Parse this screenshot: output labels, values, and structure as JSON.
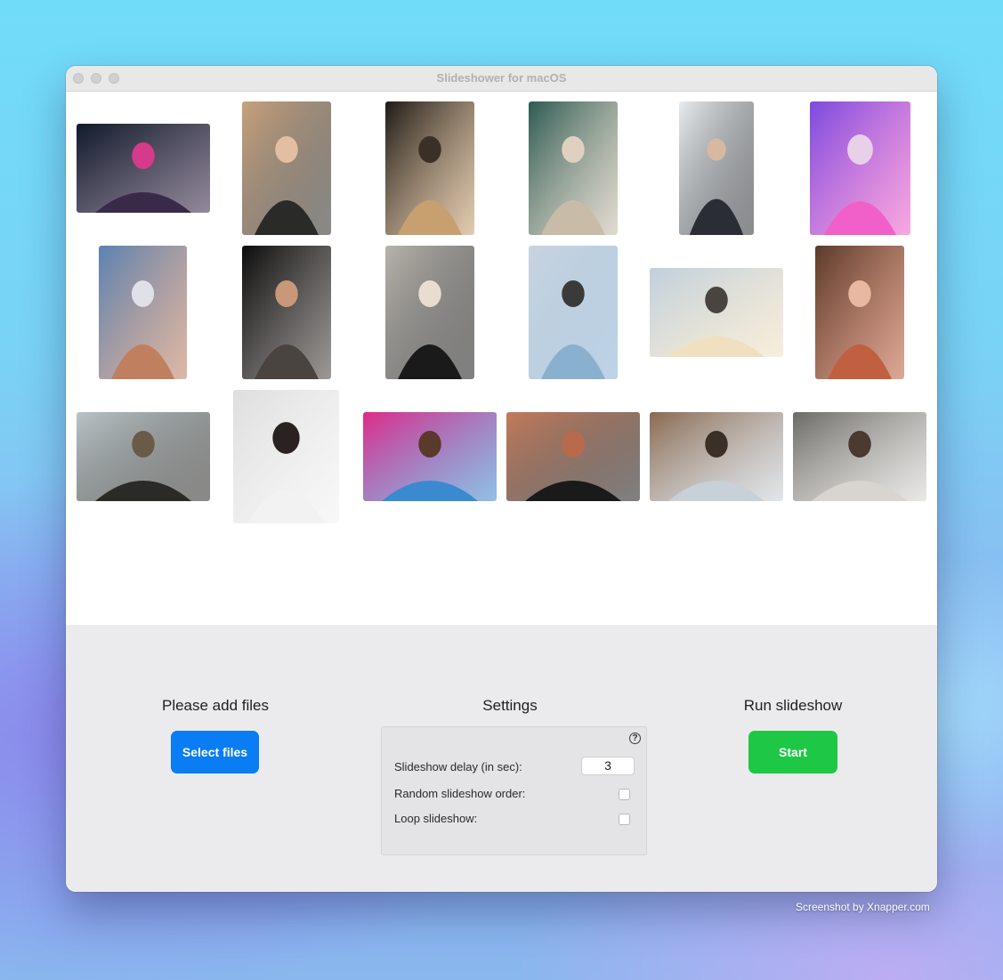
{
  "window": {
    "title": "Slideshower for macOS"
  },
  "gallery": {
    "photos": [
      {
        "name": "photo-neon-man",
        "palette": [
          "#101a2a",
          "#3a2a4a",
          "#d63a8a"
        ]
      },
      {
        "name": "photo-woman-leather-jacket",
        "palette": [
          "#c8a27c",
          "#2a2a28",
          "#e2bfa0"
        ]
      },
      {
        "name": "photo-bearded-man-lights",
        "palette": [
          "#1e1a16",
          "#c8a070",
          "#3a3026"
        ]
      },
      {
        "name": "photo-woman-peace-signs",
        "palette": [
          "#2c5a52",
          "#c8bca8",
          "#e0d0c0"
        ]
      },
      {
        "name": "photo-man-sleeveless",
        "palette": [
          "#e8ecef",
          "#2a2e34",
          "#d8b8a0"
        ]
      },
      {
        "name": "photo-woman-pink-light",
        "palette": [
          "#7a4ae0",
          "#f060c8",
          "#e8d0e8"
        ]
      },
      {
        "name": "photo-curly-hair-city",
        "palette": [
          "#5a82b4",
          "#c08060",
          "#e0e0e8"
        ]
      },
      {
        "name": "photo-man-dark-sweater",
        "palette": [
          "#0c0c0c",
          "#4a4440",
          "#c89878"
        ]
      },
      {
        "name": "photo-woman-overalls",
        "palette": [
          "#b8b4ac",
          "#1a1a1a",
          "#e8ddd0"
        ]
      },
      {
        "name": "photo-man-office",
        "palette": [
          "#c8d4e0",
          "#8ab0d0",
          "#3a3a3a"
        ]
      },
      {
        "name": "photo-friends-sunset",
        "palette": [
          "#c0d0dc",
          "#f0e0c0",
          "#4a4440"
        ]
      },
      {
        "name": "photo-redhead-smile",
        "palette": [
          "#5a3a2a",
          "#c06040",
          "#e8b8a0"
        ]
      },
      {
        "name": "photo-three-friends-tree",
        "palette": [
          "#b8c4c8",
          "#2a2a26",
          "#6a5a48"
        ]
      },
      {
        "name": "photo-woman-bun",
        "palette": [
          "#dedede",
          "#f2f2f2",
          "#2a2220"
        ]
      },
      {
        "name": "photo-man-graffiti",
        "palette": [
          "#e02a8a",
          "#3a8ad0",
          "#5a3a2a"
        ]
      },
      {
        "name": "photo-man-hat-orange",
        "palette": [
          "#c47a5a",
          "#1a1a1a",
          "#b86a4a"
        ]
      },
      {
        "name": "photo-friends-cafe",
        "palette": [
          "#8a6a50",
          "#c8d0d8",
          "#3a3028"
        ]
      },
      {
        "name": "photo-group-laptops",
        "palette": [
          "#6a6a66",
          "#d8d4d0",
          "#4a3a30"
        ]
      }
    ]
  },
  "files": {
    "heading": "Please add files",
    "button_label": "Select files",
    "button_color": "#0a7cf4"
  },
  "settings": {
    "heading": "Settings",
    "help_glyph": "?",
    "delay_label": "Slideshow delay (in sec):",
    "delay_value": "3",
    "random_label": "Random slideshow order:",
    "random_checked": false,
    "loop_label": "Loop slideshow:",
    "loop_checked": false
  },
  "run": {
    "heading": "Run slideshow",
    "button_label": "Start",
    "button_color": "#1ec745"
  },
  "watermark": {
    "text": "Screenshot by Xnapper.com"
  }
}
